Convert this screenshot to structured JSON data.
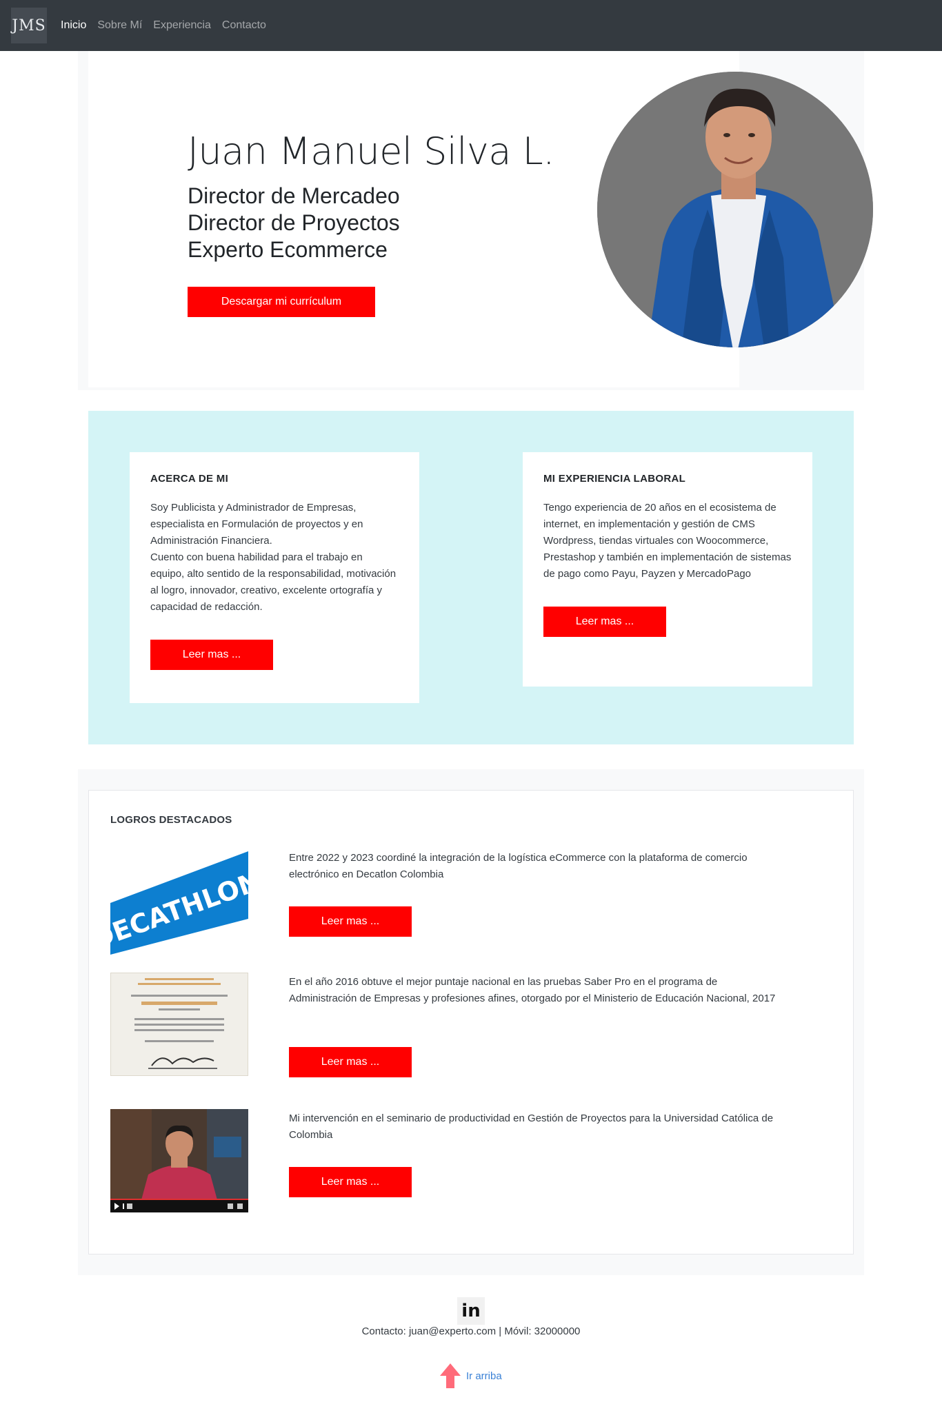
{
  "nav": {
    "logo": "JMS",
    "items": [
      {
        "label": "Inicio",
        "active": true
      },
      {
        "label": "Sobre Mí",
        "active": false
      },
      {
        "label": "Experiencia",
        "active": false
      },
      {
        "label": "Contacto",
        "active": false
      }
    ]
  },
  "hero": {
    "name": "Juan Manuel Silva L.",
    "roles": [
      "Director de Mercadeo",
      "Director de Proyectos",
      "Experto Ecommerce"
    ],
    "cv_button": "Descargar mi currículum"
  },
  "about": {
    "title": "ACERCA DE MI",
    "text_1": "Soy Publicista y Administrador de Empresas, especialista en Formulación de proyectos y en Administración Financiera.",
    "text_2": "Cuento con buena habilidad para el trabajo en equipo, alto sentido de la responsabilidad, motivación al logro, innovador, creativo, excelente ortografía y capacidad de redacción.",
    "button": "Leer mas ..."
  },
  "experience": {
    "title": "MI EXPERIENCIA LABORAL",
    "text": "Tengo experiencia de 20 años en el ecosistema de internet, en implementación y gestión de CMS Wordpress, tiendas virtuales con Woocommerce, Prestashop y también en implementación de sistemas de pago como Payu, Payzen y MercadoPago",
    "button": "Leer mas ..."
  },
  "logros": {
    "title": "LOGROS DESTACADOS",
    "items": [
      {
        "text": "Entre 2022 y 2023 coordiné la integración de la logística eCommerce con la plataforma de comercio electrónico en Decatlon Colombia",
        "button": "Leer mas ...",
        "image_word": "DECATHLON"
      },
      {
        "text": "En el año 2016 obtuve el mejor puntaje nacional en las pruebas Saber Pro en el programa de Administración de Empresas y profesiones afines, otorgado por el Ministerio de Educación Nacional, 2017",
        "button": "Leer mas ..."
      },
      {
        "text": "Mi intervención en el seminario de productividad en Gestión de Proyectos para la Universidad Católica de Colombia",
        "button": "Leer mas ..."
      }
    ]
  },
  "footer": {
    "linkedin_label": "in",
    "contact": "Contacto: juan@experto.com | Móvil: 32000000",
    "scroll_top": "Ir arriba"
  },
  "colors": {
    "navbar": "#343a40",
    "accent_red": "#ff0000",
    "about_bg": "#d4f4f6",
    "link_blue": "#3b82d6"
  }
}
